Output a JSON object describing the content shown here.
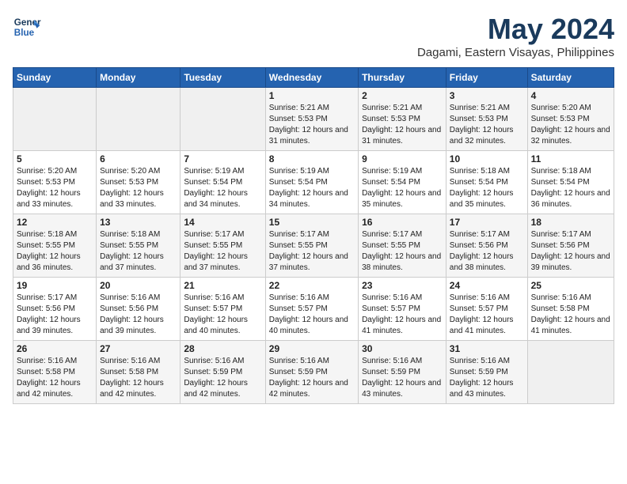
{
  "header": {
    "logo_line1": "General",
    "logo_line2": "Blue",
    "title": "May 2024",
    "subtitle": "Dagami, Eastern Visayas, Philippines"
  },
  "weekdays": [
    "Sunday",
    "Monday",
    "Tuesday",
    "Wednesday",
    "Thursday",
    "Friday",
    "Saturday"
  ],
  "weeks": [
    [
      {
        "day": "",
        "sunrise": "",
        "sunset": "",
        "daylight": ""
      },
      {
        "day": "",
        "sunrise": "",
        "sunset": "",
        "daylight": ""
      },
      {
        "day": "",
        "sunrise": "",
        "sunset": "",
        "daylight": ""
      },
      {
        "day": "1",
        "sunrise": "Sunrise: 5:21 AM",
        "sunset": "Sunset: 5:53 PM",
        "daylight": "Daylight: 12 hours and 31 minutes."
      },
      {
        "day": "2",
        "sunrise": "Sunrise: 5:21 AM",
        "sunset": "Sunset: 5:53 PM",
        "daylight": "Daylight: 12 hours and 31 minutes."
      },
      {
        "day": "3",
        "sunrise": "Sunrise: 5:21 AM",
        "sunset": "Sunset: 5:53 PM",
        "daylight": "Daylight: 12 hours and 32 minutes."
      },
      {
        "day": "4",
        "sunrise": "Sunrise: 5:20 AM",
        "sunset": "Sunset: 5:53 PM",
        "daylight": "Daylight: 12 hours and 32 minutes."
      }
    ],
    [
      {
        "day": "5",
        "sunrise": "Sunrise: 5:20 AM",
        "sunset": "Sunset: 5:53 PM",
        "daylight": "Daylight: 12 hours and 33 minutes."
      },
      {
        "day": "6",
        "sunrise": "Sunrise: 5:20 AM",
        "sunset": "Sunset: 5:53 PM",
        "daylight": "Daylight: 12 hours and 33 minutes."
      },
      {
        "day": "7",
        "sunrise": "Sunrise: 5:19 AM",
        "sunset": "Sunset: 5:54 PM",
        "daylight": "Daylight: 12 hours and 34 minutes."
      },
      {
        "day": "8",
        "sunrise": "Sunrise: 5:19 AM",
        "sunset": "Sunset: 5:54 PM",
        "daylight": "Daylight: 12 hours and 34 minutes."
      },
      {
        "day": "9",
        "sunrise": "Sunrise: 5:19 AM",
        "sunset": "Sunset: 5:54 PM",
        "daylight": "Daylight: 12 hours and 35 minutes."
      },
      {
        "day": "10",
        "sunrise": "Sunrise: 5:18 AM",
        "sunset": "Sunset: 5:54 PM",
        "daylight": "Daylight: 12 hours and 35 minutes."
      },
      {
        "day": "11",
        "sunrise": "Sunrise: 5:18 AM",
        "sunset": "Sunset: 5:54 PM",
        "daylight": "Daylight: 12 hours and 36 minutes."
      }
    ],
    [
      {
        "day": "12",
        "sunrise": "Sunrise: 5:18 AM",
        "sunset": "Sunset: 5:55 PM",
        "daylight": "Daylight: 12 hours and 36 minutes."
      },
      {
        "day": "13",
        "sunrise": "Sunrise: 5:18 AM",
        "sunset": "Sunset: 5:55 PM",
        "daylight": "Daylight: 12 hours and 37 minutes."
      },
      {
        "day": "14",
        "sunrise": "Sunrise: 5:17 AM",
        "sunset": "Sunset: 5:55 PM",
        "daylight": "Daylight: 12 hours and 37 minutes."
      },
      {
        "day": "15",
        "sunrise": "Sunrise: 5:17 AM",
        "sunset": "Sunset: 5:55 PM",
        "daylight": "Daylight: 12 hours and 37 minutes."
      },
      {
        "day": "16",
        "sunrise": "Sunrise: 5:17 AM",
        "sunset": "Sunset: 5:55 PM",
        "daylight": "Daylight: 12 hours and 38 minutes."
      },
      {
        "day": "17",
        "sunrise": "Sunrise: 5:17 AM",
        "sunset": "Sunset: 5:56 PM",
        "daylight": "Daylight: 12 hours and 38 minutes."
      },
      {
        "day": "18",
        "sunrise": "Sunrise: 5:17 AM",
        "sunset": "Sunset: 5:56 PM",
        "daylight": "Daylight: 12 hours and 39 minutes."
      }
    ],
    [
      {
        "day": "19",
        "sunrise": "Sunrise: 5:17 AM",
        "sunset": "Sunset: 5:56 PM",
        "daylight": "Daylight: 12 hours and 39 minutes."
      },
      {
        "day": "20",
        "sunrise": "Sunrise: 5:16 AM",
        "sunset": "Sunset: 5:56 PM",
        "daylight": "Daylight: 12 hours and 39 minutes."
      },
      {
        "day": "21",
        "sunrise": "Sunrise: 5:16 AM",
        "sunset": "Sunset: 5:57 PM",
        "daylight": "Daylight: 12 hours and 40 minutes."
      },
      {
        "day": "22",
        "sunrise": "Sunrise: 5:16 AM",
        "sunset": "Sunset: 5:57 PM",
        "daylight": "Daylight: 12 hours and 40 minutes."
      },
      {
        "day": "23",
        "sunrise": "Sunrise: 5:16 AM",
        "sunset": "Sunset: 5:57 PM",
        "daylight": "Daylight: 12 hours and 41 minutes."
      },
      {
        "day": "24",
        "sunrise": "Sunrise: 5:16 AM",
        "sunset": "Sunset: 5:57 PM",
        "daylight": "Daylight: 12 hours and 41 minutes."
      },
      {
        "day": "25",
        "sunrise": "Sunrise: 5:16 AM",
        "sunset": "Sunset: 5:58 PM",
        "daylight": "Daylight: 12 hours and 41 minutes."
      }
    ],
    [
      {
        "day": "26",
        "sunrise": "Sunrise: 5:16 AM",
        "sunset": "Sunset: 5:58 PM",
        "daylight": "Daylight: 12 hours and 42 minutes."
      },
      {
        "day": "27",
        "sunrise": "Sunrise: 5:16 AM",
        "sunset": "Sunset: 5:58 PM",
        "daylight": "Daylight: 12 hours and 42 minutes."
      },
      {
        "day": "28",
        "sunrise": "Sunrise: 5:16 AM",
        "sunset": "Sunset: 5:59 PM",
        "daylight": "Daylight: 12 hours and 42 minutes."
      },
      {
        "day": "29",
        "sunrise": "Sunrise: 5:16 AM",
        "sunset": "Sunset: 5:59 PM",
        "daylight": "Daylight: 12 hours and 42 minutes."
      },
      {
        "day": "30",
        "sunrise": "Sunrise: 5:16 AM",
        "sunset": "Sunset: 5:59 PM",
        "daylight": "Daylight: 12 hours and 43 minutes."
      },
      {
        "day": "31",
        "sunrise": "Sunrise: 5:16 AM",
        "sunset": "Sunset: 5:59 PM",
        "daylight": "Daylight: 12 hours and 43 minutes."
      },
      {
        "day": "",
        "sunrise": "",
        "sunset": "",
        "daylight": ""
      }
    ]
  ]
}
